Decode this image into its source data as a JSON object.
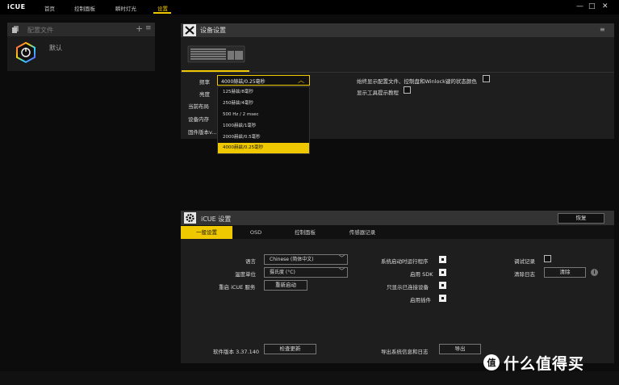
{
  "app": {
    "logo": "iCUE"
  },
  "nav": {
    "tabs": [
      {
        "label": "首页"
      },
      {
        "label": "控制面板"
      },
      {
        "label": "瞬时灯光"
      },
      {
        "label": "设置"
      }
    ],
    "active_index": 3
  },
  "window_controls": {
    "minimize": "—",
    "maximize": "□",
    "close": "✕"
  },
  "profiles": {
    "title": "配置文件",
    "add": "+",
    "menu": "≡",
    "items": [
      {
        "name": "默认"
      }
    ]
  },
  "device_settings": {
    "title": "设备设置",
    "menu": "≡",
    "labels": {
      "frequency": "频率",
      "brightness": "亮度",
      "current_layout": "当前布局",
      "device_memory": "设备内存",
      "firmware": "固件版本v..."
    },
    "frequency_selected": "4000赫兹/0.25毫秒",
    "frequency_options": [
      "125赫兹/8毫秒",
      "250赫兹/4毫秒",
      "500 Hz / 2 msec",
      "1000赫兹/1毫秒",
      "2000赫兹/0.5毫秒",
      "4000赫兹/0.25毫秒"
    ],
    "frequency_selected_index": 5,
    "option_always_show": "始终显示配置文件、控制盘和Winlock键的状态颜色",
    "option_show_tooltips": "显示工具提示教程"
  },
  "icue_settings": {
    "title": "iCUE 设置",
    "restore_label": "恢复",
    "tabs": [
      "一般设置",
      "OSD",
      "控制面板",
      "传感器记录"
    ],
    "active_tab": 0,
    "language_label": "语言",
    "language_value": "Chinese (简体中文)",
    "temp_unit_label": "温度单位",
    "temp_unit_value": "摄氏度 (°C)",
    "restart_label": "重启 iCUE 服务",
    "restart_button": "重新启动",
    "run_on_startup": "系统启动时运行程序",
    "enable_sdk": "启用 SDK",
    "show_connected_only": "只显示已连接设备",
    "enable_plugins": "启用插件",
    "debug_log": "调试记录",
    "clear_log_label": "清除日志",
    "clear_button": "清除",
    "version_label": "软件版本 3.37.140",
    "check_update": "检查更新",
    "export_label": "导出系统信息和日志",
    "export_button": "导出"
  },
  "watermark": {
    "text": "什么值得买"
  },
  "colors": {
    "accent": "#f0c800",
    "panel": "#1e1e1e",
    "header": "#333333"
  }
}
